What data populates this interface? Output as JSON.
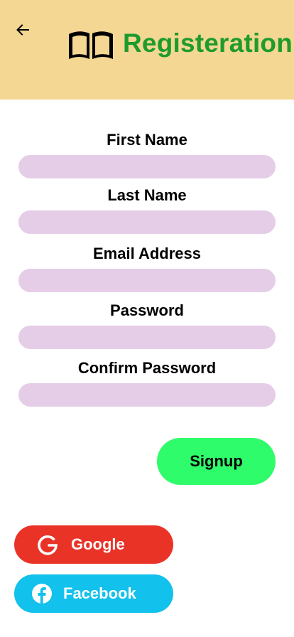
{
  "header": {
    "title": "Registeration",
    "background": "#f3d793",
    "title_color": "#1e9b2d",
    "back_icon": "arrow-left-icon",
    "logo_icon": "open-book-icon"
  },
  "form": {
    "first_name_label": "First Name",
    "first_name_value": "",
    "last_name_label": "Last Name",
    "last_name_value": "",
    "email_label": "Email Address",
    "email_value": "",
    "password_label": "Password",
    "password_value": "",
    "confirm_password_label": "Confirm Password",
    "confirm_password_value": "",
    "field_color": "#e5cde8"
  },
  "actions": {
    "signup_label": "Signup",
    "signup_color": "#2efc6a"
  },
  "social": {
    "google_label": "Google",
    "google_color": "#e93327",
    "google_icon": "google-icon",
    "facebook_label": "Facebook",
    "facebook_color": "#12c1ec",
    "facebook_icon": "facebook-icon"
  }
}
